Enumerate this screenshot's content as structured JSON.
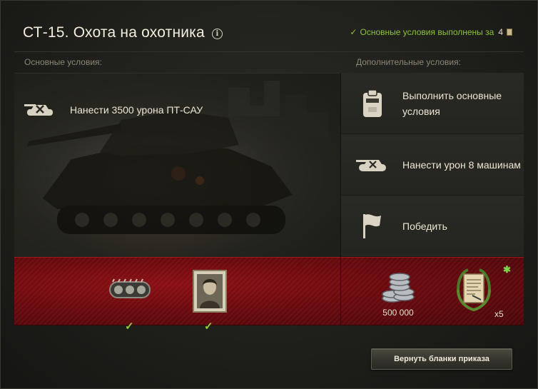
{
  "header": {
    "title": "СТ-15. Охота на охотника",
    "info_icon": "info-icon",
    "status_text": "Основные условия выполнены за",
    "status_count": "4",
    "status_color": "#8fc23a"
  },
  "labels": {
    "main_conditions": "Основные условия:",
    "extra_conditions": "Дополнительные условия:"
  },
  "main_condition": {
    "icon": "spg-tank-icon",
    "text": "Нанести 3500 урона ПТ-САУ"
  },
  "extra_conditions": [
    {
      "icon": "clipboard-icon",
      "text": "Выполнить основные условия"
    },
    {
      "icon": "tank-icon",
      "text": "Нанести урон 8 машинам"
    },
    {
      "icon": "flag-icon",
      "text": "Победить"
    }
  ],
  "rewards": {
    "main": [
      {
        "icon": "tank-track-icon",
        "received": true
      },
      {
        "icon": "crew-portrait-icon",
        "received": true
      }
    ],
    "extra": [
      {
        "icon": "silver-coins-icon",
        "qty": "500 000"
      },
      {
        "icon": "order-form-icon",
        "qty": "x5",
        "new": true
      }
    ]
  },
  "button": {
    "label": "Вернуть бланки приказа"
  },
  "colors": {
    "accent_green": "#8fc23a",
    "reward_red": "#7a0c11",
    "text": "#ece6d3"
  }
}
